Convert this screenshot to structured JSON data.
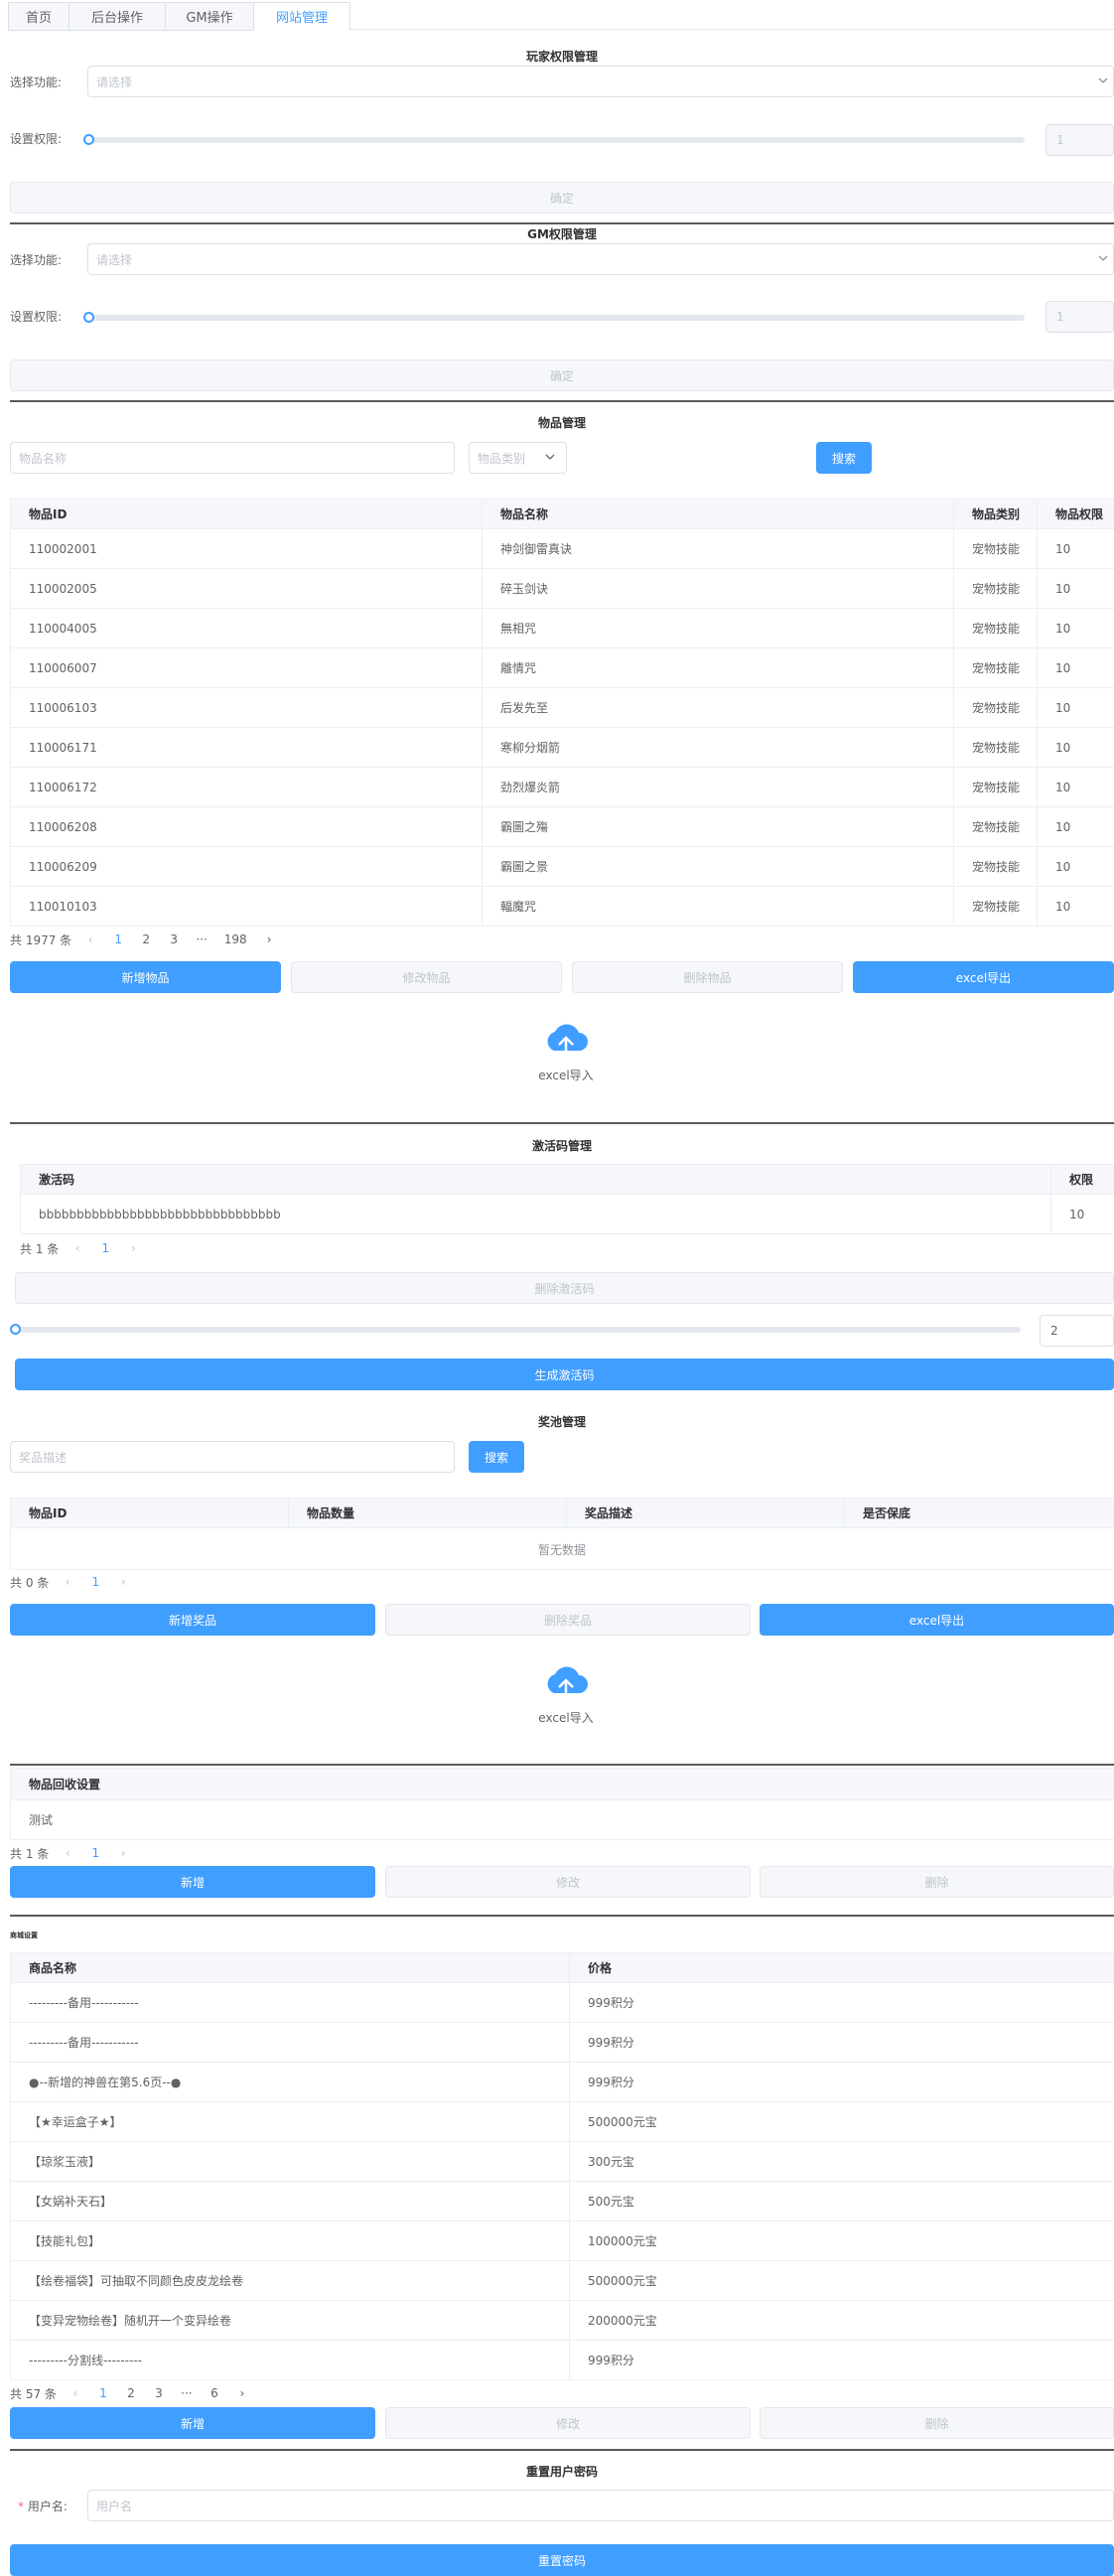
{
  "tabs": [
    "首页",
    "后台操作",
    "GM操作",
    "网站管理"
  ],
  "player_perm": {
    "title": "玩家权限管理",
    "select_label": "选择功能:",
    "select_placeholder": "请选择",
    "perm_label": "设置权限:",
    "number": "1",
    "confirm": "确定"
  },
  "gm_perm": {
    "title": "GM权限管理",
    "select_label": "选择功能:",
    "select_placeholder": "请选择",
    "perm_label": "设置权限:",
    "number": "1",
    "confirm": "确定"
  },
  "items": {
    "title": "物品管理",
    "name_placeholder": "物品名称",
    "category_placeholder": "物品类别",
    "search": "搜索",
    "headers": [
      "物品ID",
      "物品名称",
      "物品类别",
      "物品权限"
    ],
    "rows": [
      [
        "110002001",
        "神剑御雷真诀",
        "宠物技能",
        "10"
      ],
      [
        "110002005",
        "碎玉剑诀",
        "宠物技能",
        "10"
      ],
      [
        "110004005",
        "無相咒",
        "宠物技能",
        "10"
      ],
      [
        "110006007",
        "離情咒",
        "宠物技能",
        "10"
      ],
      [
        "110006103",
        "后发先至",
        "宠物技能",
        "10"
      ],
      [
        "110006171",
        "寒柳分烟箭",
        "宠物技能",
        "10"
      ],
      [
        "110006172",
        "劲烈爆炎箭",
        "宠物技能",
        "10"
      ],
      [
        "110006208",
        "霸圖之殤",
        "宠物技能",
        "10"
      ],
      [
        "110006209",
        "霸圖之景",
        "宠物技能",
        "10"
      ],
      [
        "110010103",
        "輻魔咒",
        "宠物技能",
        "10"
      ]
    ],
    "pager": {
      "total": "共 1977 条",
      "pages": [
        "1",
        "2",
        "3",
        "···",
        "198"
      ]
    },
    "buttons": [
      "新增物品",
      "修改物品",
      "删除物品",
      "excel导出"
    ],
    "upload": "excel导入"
  },
  "codes": {
    "title": "激活码管理",
    "headers": [
      "激活码",
      "权限"
    ],
    "rows": [
      [
        "bbbbbbbbbbbbbbbbbbbbbbbbbbbbbbbb",
        "10"
      ]
    ],
    "pager": {
      "total": "共 1 条",
      "pages": [
        "1"
      ]
    },
    "delete": "删除激活码",
    "number": "2",
    "generate": "生成激活码"
  },
  "pool": {
    "title": "奖池管理",
    "desc_placeholder": "奖品描述",
    "search": "搜索",
    "headers": [
      "物品ID",
      "物品数量",
      "奖品描述",
      "是否保底"
    ],
    "empty": "暂无数据",
    "pager": {
      "total": "共 0 条",
      "pages": [
        "1"
      ]
    },
    "buttons": [
      "新增奖品",
      "删除奖品",
      "excel导出"
    ],
    "upload": "excel导入"
  },
  "recycle": {
    "header": "物品回收设置",
    "rows": [
      "测试"
    ],
    "pager": {
      "total": "共 1 条",
      "pages": [
        "1"
      ]
    },
    "buttons": [
      "新增",
      "修改",
      "删除"
    ]
  },
  "shop": {
    "title": "商城设置",
    "headers": [
      "商品名称",
      "价格"
    ],
    "rows": [
      [
        "---------备用-----------",
        "999积分"
      ],
      [
        "---------备用-----------",
        "999积分"
      ],
      [
        "●--新增的神兽在第5.6页--●",
        "999积分"
      ],
      [
        "【★幸运盒子★】",
        "500000元宝"
      ],
      [
        "【琼浆玉液】",
        "300元宝"
      ],
      [
        "【女娲补天石】",
        "500元宝"
      ],
      [
        "【技能礼包】",
        "100000元宝"
      ],
      [
        "【绘卷福袋】可抽取不同颜色皮皮龙绘卷",
        "500000元宝"
      ],
      [
        "【变异宠物绘卷】随机开一个变异绘卷",
        "200000元宝"
      ],
      [
        "---------分割线---------",
        "999积分"
      ]
    ],
    "pager": {
      "total": "共 57 条",
      "pages": [
        "1",
        "2",
        "3",
        "···",
        "6"
      ]
    },
    "buttons": [
      "新增",
      "修改",
      "删除"
    ]
  },
  "reset": {
    "title": "重置用户密码",
    "user_label": "用户名:",
    "required_mark": "*",
    "user_placeholder": "用户名",
    "button": "重置密码"
  },
  "colors": {
    "primary": "#409eff",
    "border": "#dcdfe6",
    "header_bg": "#f5f7fa"
  }
}
